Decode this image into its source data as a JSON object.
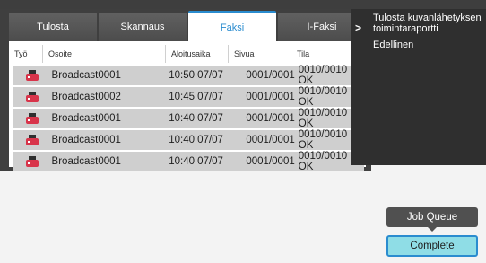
{
  "tabs": [
    {
      "label": "Tulosta",
      "active": false
    },
    {
      "label": "Skannaus",
      "active": false
    },
    {
      "label": "Faksi",
      "active": true
    },
    {
      "label": "I-Faksi",
      "active": false
    }
  ],
  "table": {
    "columns": [
      "Työ",
      "Osoite",
      "Aloitusaika",
      "Sivua",
      "Tila"
    ],
    "rows": [
      {
        "icon": "fax-job-icon",
        "address": "Broadcast0001",
        "time": "10:50 07/07",
        "pages": "0001/0001",
        "status": "0010/0010 OK"
      },
      {
        "icon": "fax-job-icon",
        "address": "Broadcast0002",
        "time": "10:45 07/07",
        "pages": "0001/0001",
        "status": "0010/0010 OK"
      },
      {
        "icon": "fax-job-icon",
        "address": "Broadcast0001",
        "time": "10:40 07/07",
        "pages": "0001/0001",
        "status": "0010/0010 OK"
      },
      {
        "icon": "fax-job-icon",
        "address": "Broadcast0001",
        "time": "10:40 07/07",
        "pages": "0001/0001",
        "status": "0010/0010 OK"
      },
      {
        "icon": "fax-job-icon",
        "address": "Broadcast0001",
        "time": "10:40 07/07",
        "pages": "0001/0001",
        "status": "0010/0010 OK"
      }
    ]
  },
  "side_menu": {
    "chevron": ">",
    "items": [
      "Tulosta kuvanlähetyksen toimintaraportti",
      "Edellinen"
    ]
  },
  "buttons": {
    "job_queue": "Job Queue",
    "complete": "Complete"
  },
  "colors": {
    "accent": "#2a8ccf",
    "complete_bg": "#8fdde6",
    "icon_red": "#d8344a"
  }
}
